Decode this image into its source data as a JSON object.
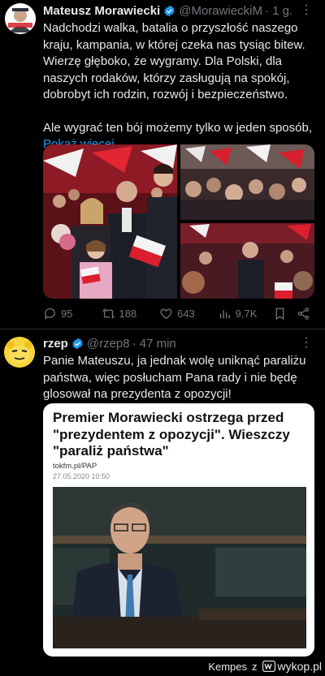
{
  "tweet1": {
    "name": "Mateusz Morawiecki",
    "handle": "@MorawieckiM",
    "time": "· 1 g.",
    "text": "Nadchodzi walka, batalia o przyszłość naszego kraju, kampania, w której czeka nas tysiąc bitew. Wierzę głęboko, że wygramy. Dla Polski, dla naszych rodaków, którzy zasługują na spokój, dobrobyt ich rodzin, rozwój i bezpieczeństwo.",
    "text2": "Ale wygrać ten bój możemy tylko w jeden sposób,",
    "show_more": "Pokaż więcej",
    "replies": "95",
    "retweets": "188",
    "likes": "643",
    "views": "9,7K"
  },
  "tweet2": {
    "name": "rzep",
    "handle": "@rzep8",
    "time": "· 47 min",
    "text": "Panie Mateuszu, ja jednak wolę uniknąć paraliżu państwa, więc posłucham Pana rady i nie będę glosował na prezydenta z opozycji!"
  },
  "card": {
    "title": "Premier Morawiecki ostrzega przed \"prezydentem z opozycji\". Wieszczy \"paraliż państwa\"",
    "source": "tokfm.pl/PAP",
    "date": "27.05.2020 10:50"
  },
  "footer": {
    "author": "Kempes",
    "z": "z",
    "site": "wykop.pl"
  },
  "colors": {
    "background": "#000000",
    "accent": "#1d9bf0",
    "muted": "#71767b",
    "text": "#e7e9ea"
  }
}
